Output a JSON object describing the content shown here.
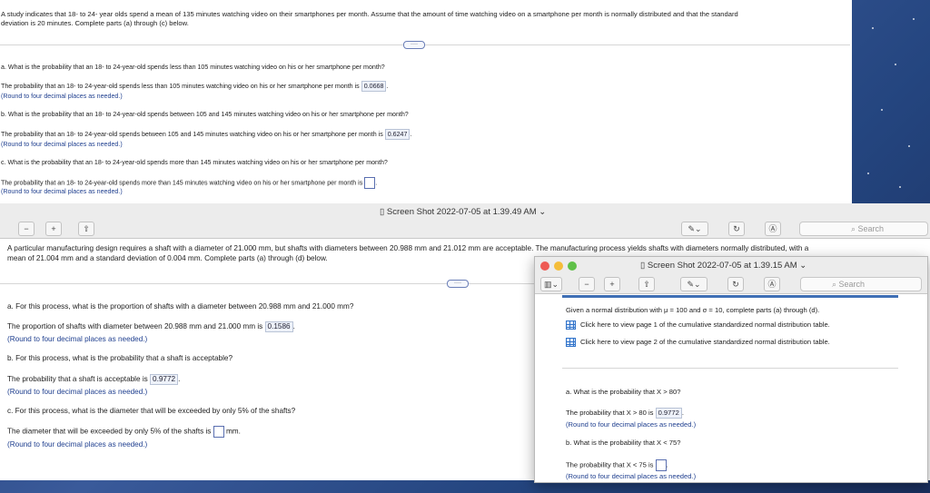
{
  "win1": {
    "intro_line1": "A study indicates that 18- to 24- year olds spend a mean of 135 minutes watching video on their smartphones per month. Assume that the amount of time watching video on a smartphone per month is normally distributed and that the standard",
    "intro_line2": "deviation is 20 minutes. Complete parts (a) through (c) below.",
    "qa": "a. What is the probability that an 18- to 24-year-old spends less than 105 minutes watching video on his or her smartphone per month?",
    "aa_text": "The probability that an 18- to 24-year-old spends less than 105 minutes watching video on his or her smartphone per month is",
    "aa_value": "0.0668",
    "qb": "b. What is the probability that an 18- to 24-year-old spends between 105 and 145 minutes watching video on his or her smartphone per month?",
    "ab_text": "The probability that an 18- to 24-year-old spends between 105 and 145 minutes watching video on his or her smartphone per month is",
    "ab_value": "0.6247",
    "qc": "c. What is the probability that an 18- to 24-year-old spends more than 145 minutes watching video on his or her smartphone per month?",
    "ac_text": "The probability that an 18- to 24-year-old spends more than 145 minutes watching video on his or her smartphone per month is",
    "hint": "(Round to four decimal places as needed.)"
  },
  "win2": {
    "title": "Screen Shot 2022-07-05 at 1.39.49 AM",
    "search": "Search",
    "intro_line1": "A particular manufacturing design requires a shaft with a diameter of 21.000 mm, but shafts with diameters between 20.988 mm and 21.012 mm are acceptable. The manufacturing process yields shafts with diameters normally distributed, with a",
    "intro_line2": "mean of 21.004 mm and a standard deviation of 0.004 mm. Complete parts (a) through (d) below.",
    "qa": "a. For this process, what is the proportion of shafts with a diameter between 20.988 mm and 21.000 mm?",
    "aa_text": "The proportion of shafts with diameter between 20.988 mm and 21.000 mm is",
    "aa_value": "0.1586",
    "qb": "b. For this process, what is the probability that a shaft is acceptable?",
    "ab_text": "The probability that a shaft is acceptable is",
    "ab_value": "0.9772",
    "qc": "c. For this process, what is the diameter that will be exceeded by only 5% of the shafts?",
    "ac_text": "The diameter that will be exceeded by only 5% of the shafts is",
    "ac_unit": "mm.",
    "hint": "(Round to four decimal places as needed.)"
  },
  "win3": {
    "title": "Screen Shot 2022-07-05 at 1.39.15 AM",
    "search": "Search",
    "given": "Given a normal distribution with μ = 100 and σ = 10, complete parts (a) through (d).",
    "link1": "Click here to view page 1 of the cumulative standardized normal distribution table.",
    "link2": "Click here to view page 2 of the cumulative standardized normal distribution table.",
    "qa": "a. What is the probability that X > 80?",
    "aa_text": "The probability that X > 80 is",
    "aa_value": "0.9772",
    "qb": "b. What is the probability that X < 75?",
    "ab_text": "The probability that X < 75 is",
    "hint": "(Round to four decimal places as needed.)"
  }
}
